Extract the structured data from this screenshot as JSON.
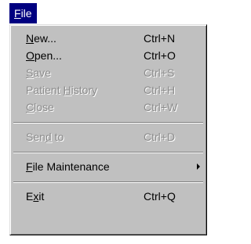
{
  "menubar": {
    "title_pre": "",
    "title_ul": "F",
    "title_post": "ile"
  },
  "menu": {
    "new": {
      "pre": "",
      "ul": "N",
      "post": "ew...",
      "shortcut": "Ctrl+N"
    },
    "open": {
      "pre": "",
      "ul": "O",
      "post": "pen...",
      "shortcut": "Ctrl+O"
    },
    "save": {
      "pre": "",
      "ul": "S",
      "post": "ave",
      "shortcut": "Ctrl+S"
    },
    "history": {
      "pre": "Patient ",
      "ul": "H",
      "post": "istory",
      "shortcut": "Ctrl+H"
    },
    "close": {
      "pre": "",
      "ul": "C",
      "post": "lose",
      "shortcut": "Ctrl+W"
    },
    "sendto": {
      "pre": "Sen",
      "ul": "d",
      "post": " to",
      "shortcut": "Ctrl+D"
    },
    "maintenance": {
      "pre": "",
      "ul": "F",
      "post": "ile Maintenance"
    },
    "exit": {
      "pre": "E",
      "ul": "x",
      "post": "it",
      "shortcut": "Ctrl+Q"
    }
  }
}
